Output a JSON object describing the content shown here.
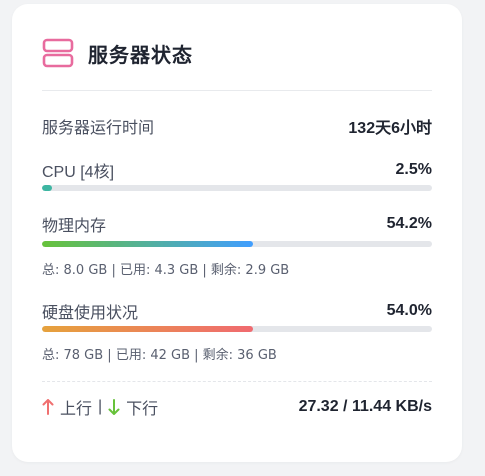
{
  "card": {
    "title": "服务器状态",
    "icon": "server-icon",
    "icon_color": "#e86b9e"
  },
  "uptime": {
    "label": "服务器运行时间",
    "value": "132天6小时"
  },
  "cpu": {
    "label": "CPU [4核]",
    "value": "2.5%",
    "percent": 2.5,
    "color": "#3db6a2"
  },
  "memory": {
    "label": "物理内存",
    "value": "54.2%",
    "percent": 54.2,
    "detail": "总: 8.0 GB | 已用: 4.3 GB | 剩余: 2.9 GB"
  },
  "disk": {
    "label": "硬盘使用状况",
    "value": "54.0%",
    "percent": 54.0,
    "detail": "总: 78 GB | 已用: 42 GB | 剩余: 36 GB"
  },
  "network": {
    "up_label": "上行",
    "separator": "|",
    "down_label": "下行",
    "up_icon": "arrow-up-icon",
    "down_icon": "arrow-down-icon",
    "up_color": "#f07070",
    "down_color": "#67c23a",
    "value": "27.32 / 11.44 KB/s"
  }
}
